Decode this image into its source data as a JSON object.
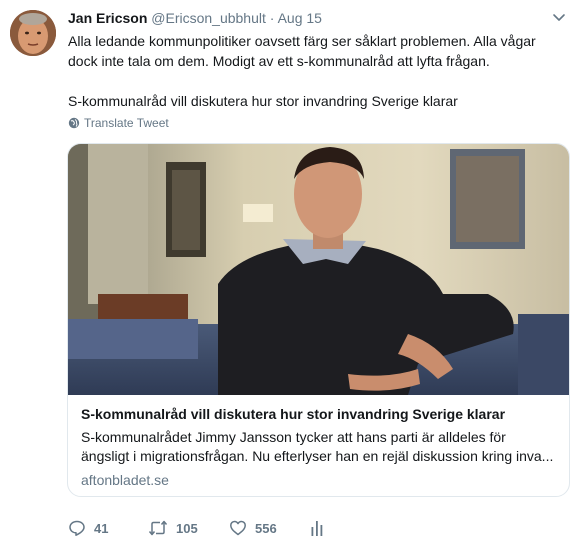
{
  "tweet": {
    "author_name": "Jan Ericson",
    "author_handle": "@Ericson_ubbhult",
    "separator": "·",
    "date": "Aug 15",
    "text_line1": "Alla ledande kommunpolitiker oavsett färg ser såklart problemen. Alla vågar dock inte tala om dem. Modigt av ett s-kommunalråd att lyfta frågan.",
    "text_line2": "S-kommunalråd vill diskutera hur stor invandring Sverige klarar",
    "translate_label": "Translate Tweet"
  },
  "card": {
    "title": "S-kommunalråd vill diskutera hur stor invandring Sverige klarar",
    "description_line1": "S-kommunalrådet Jimmy Jansson tycker att hans parti är alldeles för",
    "description_line2": "ängsligt i migrationsfrågan. Nu efterlyser han en rejäl diskussion kring inva...",
    "domain": "aftonbladet.se"
  },
  "actions": {
    "replies": "41",
    "retweets": "105",
    "likes": "556"
  },
  "icons": {
    "caret": "chevron-down-icon",
    "translate": "globe-icon",
    "reply": "reply-icon",
    "retweet": "retweet-icon",
    "like": "heart-icon",
    "analytics": "analytics-icon"
  }
}
